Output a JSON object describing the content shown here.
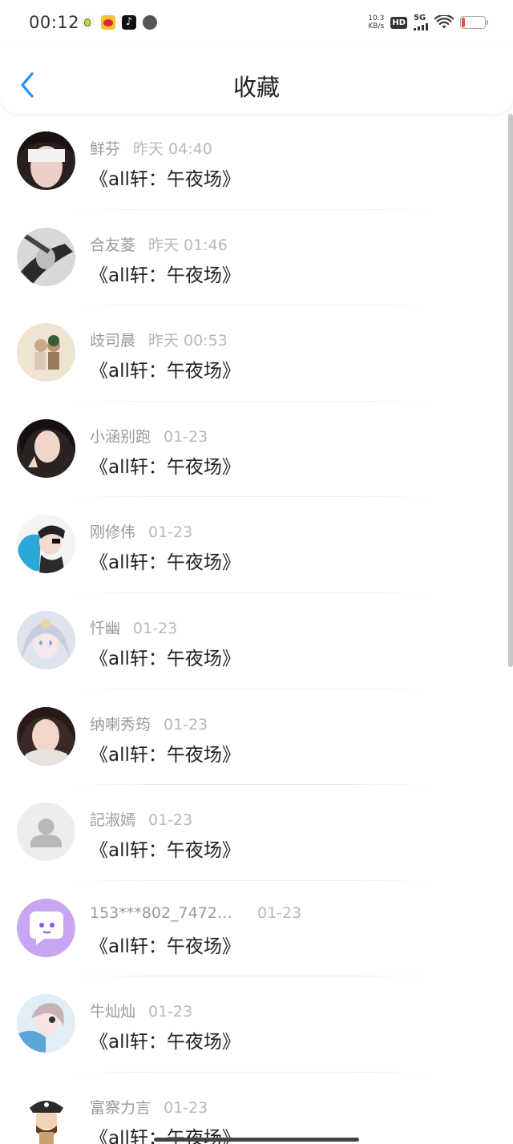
{
  "status_bar": {
    "time": "00:12",
    "net_speed_value": "10.3",
    "net_speed_unit": "KB/s",
    "hd": "HD",
    "network": "5G",
    "battery": "13",
    "battery_level": 0.13,
    "battery_color": "#e8514a",
    "apps": [
      "qq-icon",
      "weibo-icon",
      "tiktok-icon",
      "message-icon"
    ]
  },
  "header": {
    "title": "收藏",
    "back_icon": "chevron-left-icon",
    "accent": "#1e90ff"
  },
  "favorites": [
    {
      "author": "鲜芬",
      "date": "昨天 04:40",
      "title": "《all轩：午夜场》",
      "avatar": "photo"
    },
    {
      "author": "合友菱",
      "date": "昨天 01:46",
      "title": "《all轩：午夜场》",
      "avatar": "photo"
    },
    {
      "author": "歧司晨",
      "date": "昨天 00:53",
      "title": "《all轩：午夜场》",
      "avatar": "photo"
    },
    {
      "author": "小涵别跑",
      "date": "01-23",
      "title": "《all轩：午夜场》",
      "avatar": "photo"
    },
    {
      "author": "刚修伟",
      "date": "01-23",
      "title": "《all轩：午夜场》",
      "avatar": "photo"
    },
    {
      "author": "忏幽",
      "date": "01-23",
      "title": "《all轩：午夜场》",
      "avatar": "photo"
    },
    {
      "author": "纳喇秀筠",
      "date": "01-23",
      "title": "《all轩：午夜场》",
      "avatar": "photo"
    },
    {
      "author": "記淑嫣",
      "date": "01-23",
      "title": "《all轩：午夜场》",
      "avatar": "default-person-icon"
    },
    {
      "author": "153***802_7472…",
      "date": "01-23",
      "title": "《all轩：午夜场》",
      "avatar": "chat-bubble-icon"
    },
    {
      "author": "牛灿灿",
      "date": "01-23",
      "title": "《all轩：午夜场》",
      "avatar": "photo"
    },
    {
      "author": "富察力言",
      "date": "01-23",
      "title": "《all轩：午夜场》",
      "avatar": "pirate-icon"
    }
  ]
}
